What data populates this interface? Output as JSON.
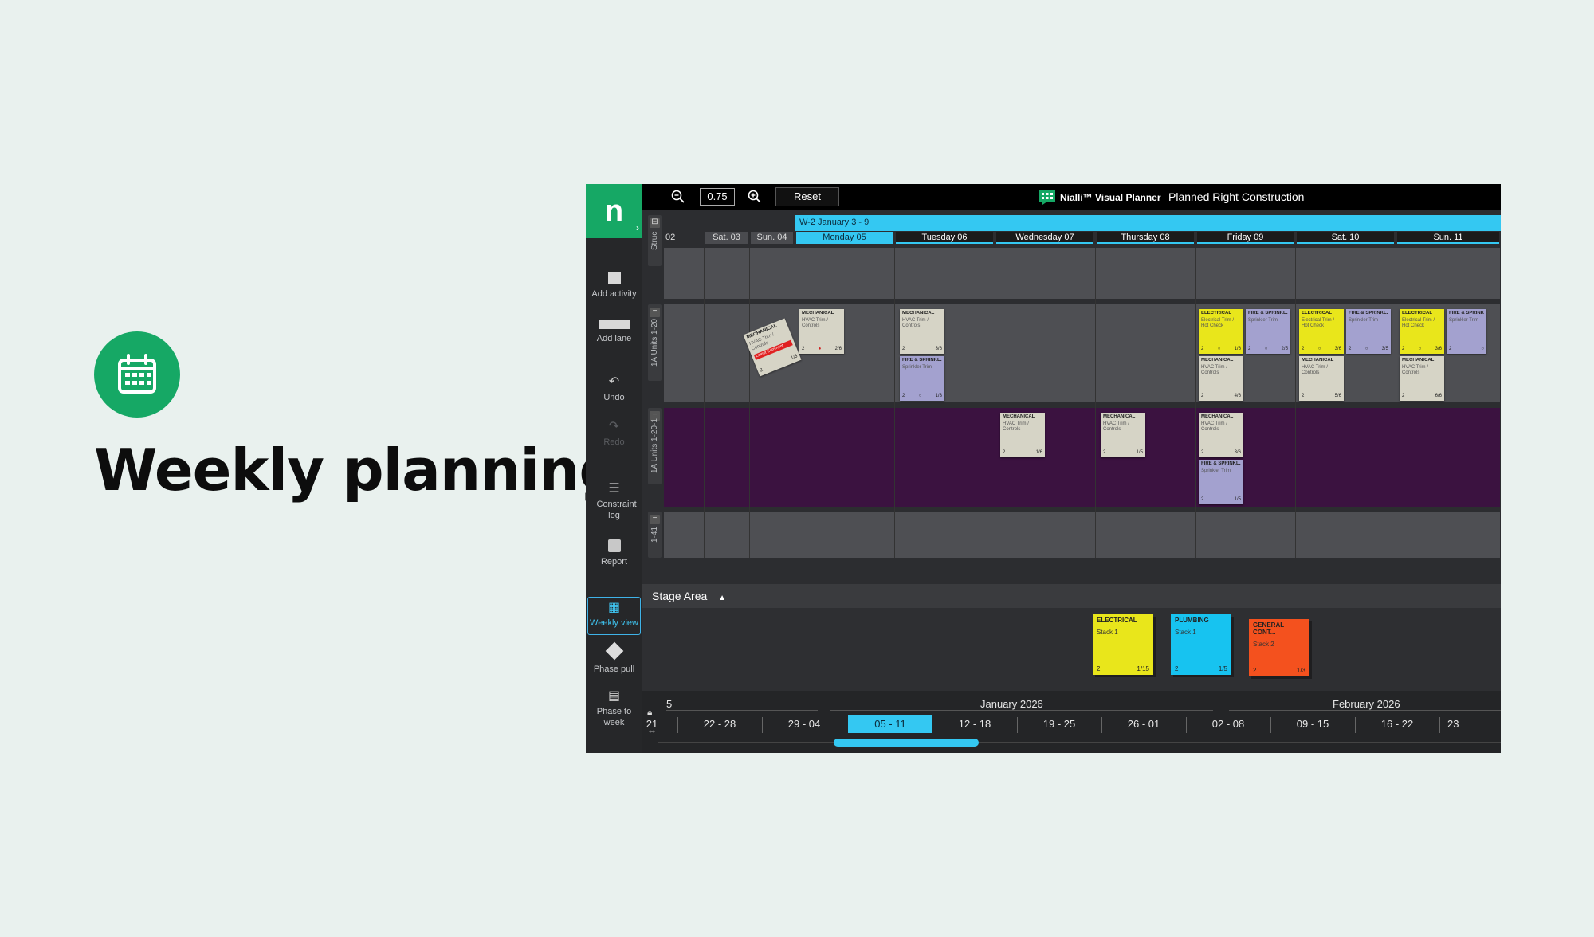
{
  "hero": {
    "title": "Weekly planning"
  },
  "toolbar": {
    "zoom_value": "0.75",
    "reset_label": "Reset",
    "brand": "Nialli™ Visual Planner",
    "project": "Planned Right Construction"
  },
  "sidebar": {
    "logo": "n",
    "items": [
      {
        "label": "Add activity"
      },
      {
        "label": "Add lane"
      },
      {
        "label": "Undo"
      },
      {
        "label": "Redo"
      },
      {
        "label": "Constraint log"
      },
      {
        "label": "Report"
      },
      {
        "label": "Weekly view"
      },
      {
        "label": "Phase pull"
      },
      {
        "label": "Phase to week"
      }
    ]
  },
  "board": {
    "week_band": "W-2 January 3 - 9",
    "days": [
      "02",
      "Sat. 03",
      "Sun. 04",
      "Monday 05",
      "Tuesday 06",
      "Wednesday 07",
      "Thursday 08",
      "Friday 09",
      "Sat. 10",
      "Sun. 11"
    ],
    "lanes": [
      "Struc",
      "1A Units 1-20",
      "1A Units 1-20-1",
      "1-41"
    ]
  },
  "cards": {
    "mech_title": "MECHANICAL",
    "mech_sub": "HVAC Trim / Controls",
    "fire_title": "FIRE & SPRINKL...",
    "fire_sub": "Sprinkler Trim",
    "elec_title": "ELECTRICAL",
    "elec_sub": "Electrical Trim / Hot Check",
    "crew": "2",
    "tilted_tag": "Latest Comment",
    "tilted_count": "1/5",
    "c_26": "2/6",
    "c_36": "3/6",
    "c_13": "1/3",
    "c_16": "1/6",
    "c_46": "4/6",
    "c_25": "2/5",
    "c_56": "5/6",
    "c_35": "3/5",
    "c_66": "6/6",
    "c_15": "1/5"
  },
  "stage": {
    "title": "Stage Area",
    "stacks": [
      {
        "title": "ELECTRICAL",
        "sub": "Stack 1",
        "crew": "2",
        "count": "1/15"
      },
      {
        "title": "PLUMBING",
        "sub": "Stack 1",
        "crew": "2",
        "count": "1/5"
      },
      {
        "title": "GENERAL CONT...",
        "sub": "Stack 2",
        "crew": "2",
        "count": "1/3"
      }
    ]
  },
  "timeline": {
    "month_left": "5",
    "month_jan": "January 2026",
    "month_feb": "February 2026",
    "weeks": [
      "21",
      "22 - 28",
      "29 - 04",
      "05 - 11",
      "12 - 18",
      "19 - 25",
      "26 - 01",
      "02 - 08",
      "09 - 15",
      "16 - 22",
      "23"
    ]
  },
  "colors": {
    "brand_green": "#16a865",
    "accent_cyan": "#34c8f2",
    "electrical": "#e9e61b",
    "plumbing": "#17c3f0",
    "general": "#f4511e",
    "mechanical": "#d6d4c6",
    "fire": "#a3a1cf"
  }
}
